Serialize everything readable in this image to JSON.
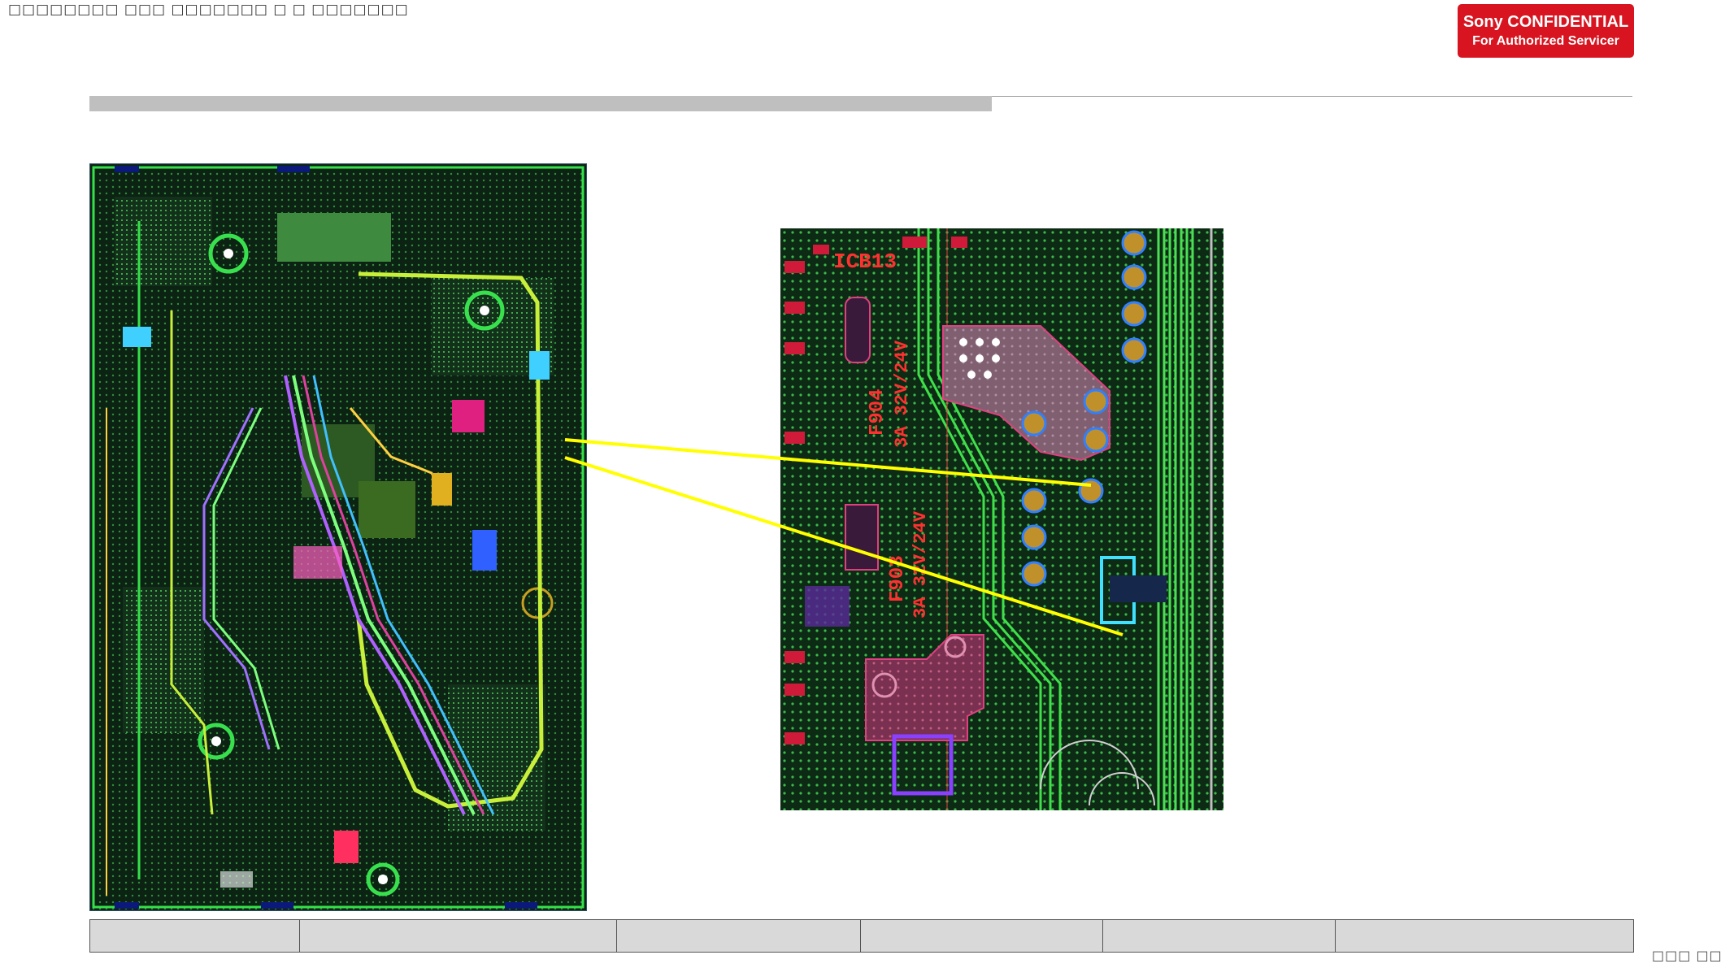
{
  "header": {
    "doc_text": "□□□□□□□□ □□□ □□□□□□□ □ □ □□□□□□□",
    "badge_line1": "Sony CONFIDENTIAL",
    "badge_line2": "For Authorized Servicer",
    "badge_color": "#d7141f"
  },
  "zoom_labels": {
    "ref_top": "ICB13",
    "fuse1": "F904",
    "fuse1_rating": "3A 32V/24V",
    "fuse2": "F903",
    "fuse2_rating": "3A 32V/24V"
  },
  "colors": {
    "pcb_background": "#0b1a12",
    "trace_green": "#3ed64a",
    "callout": "#ffff00",
    "title_bar": "#bfbfbf"
  },
  "footer": {
    "cells": [
      "",
      "",
      "",
      "",
      "",
      ""
    ]
  },
  "page_number": "□□□ □□□"
}
